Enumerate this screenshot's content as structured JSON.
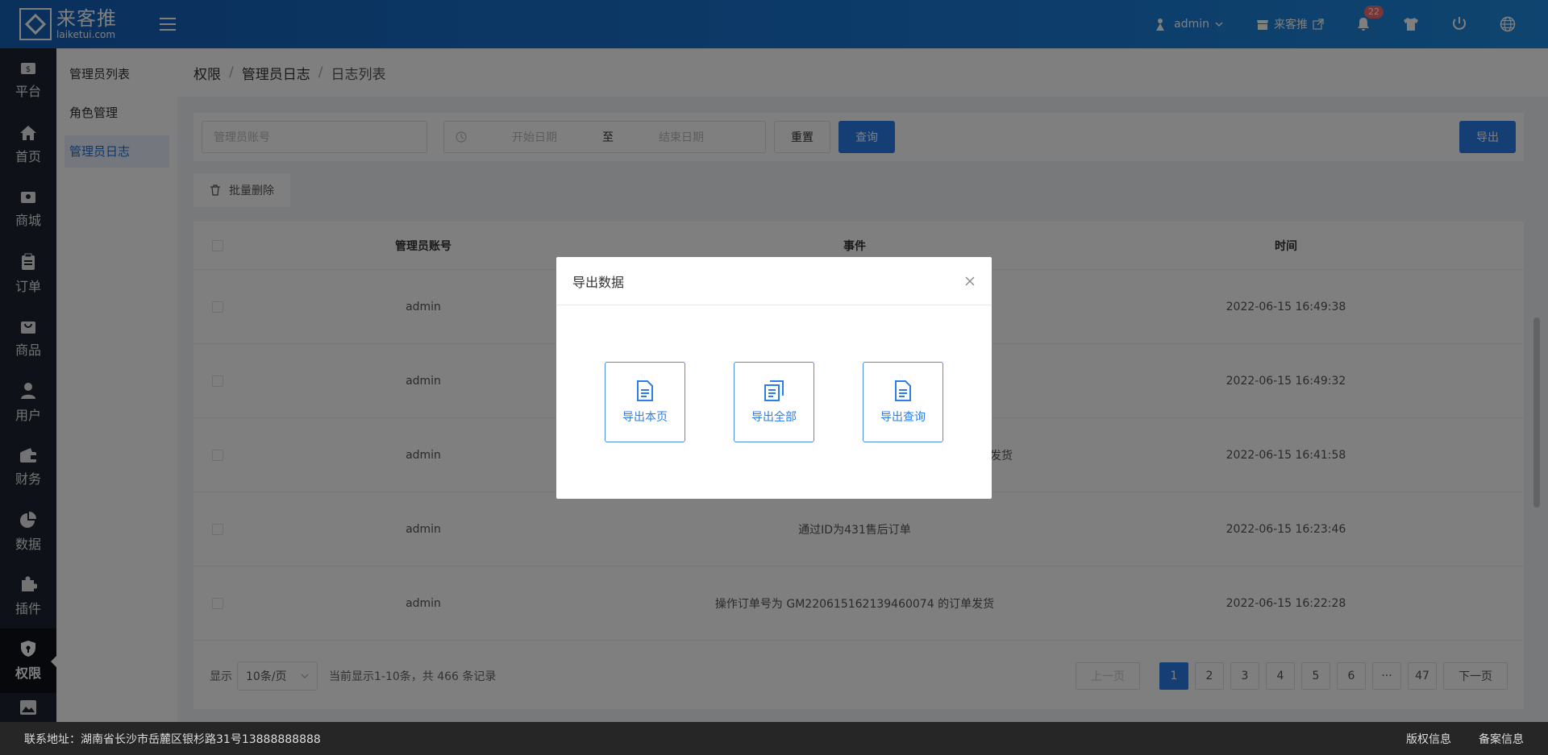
{
  "brand": {
    "cn": "来客推",
    "en": "laiketui.com"
  },
  "header": {
    "user": "admin",
    "store": "来客推",
    "notif_count": "22"
  },
  "sidebar": {
    "items": [
      {
        "label": "平台",
        "icon": "dollar-icon"
      },
      {
        "label": "首页",
        "icon": "home-icon"
      },
      {
        "label": "商城",
        "icon": "mall-icon"
      },
      {
        "label": "订单",
        "icon": "clipboard-icon"
      },
      {
        "label": "商品",
        "icon": "bag-icon"
      },
      {
        "label": "用户",
        "icon": "user-icon"
      },
      {
        "label": "财务",
        "icon": "wallet-icon"
      },
      {
        "label": "数据",
        "icon": "pie-icon"
      },
      {
        "label": "插件",
        "icon": "puzzle-icon"
      },
      {
        "label": "权限",
        "icon": "shield-icon"
      }
    ]
  },
  "subnav": {
    "items": [
      "管理员列表",
      "角色管理",
      "管理员日志"
    ]
  },
  "breadcrumb": {
    "a": "权限",
    "b": "管理员日志",
    "c": "日志列表",
    "sep": "/"
  },
  "filter": {
    "account_placeholder": "管理员账号",
    "start_placeholder": "开始日期",
    "to": "至",
    "end_placeholder": "结束日期",
    "reset": "重置",
    "search": "查询",
    "export": "导出"
  },
  "bulk_delete": "批量删除",
  "table": {
    "headers": {
      "account": "管理员账号",
      "event": "事件",
      "time": "时间"
    },
    "rows": [
      {
        "account": "admin",
        "event": "",
        "time": "2022-06-15 16:49:38"
      },
      {
        "account": "admin",
        "event": "",
        "time": "2022-06-15 16:49:32"
      },
      {
        "account": "admin",
        "event": "发货",
        "time": "2022-06-15 16:41:58"
      },
      {
        "account": "admin",
        "event": "通过ID为431售后订单",
        "time": "2022-06-15 16:23:46"
      },
      {
        "account": "admin",
        "event": "操作订单号为 GM220615162139460074 的订单发货",
        "time": "2022-06-15 16:22:28"
      }
    ]
  },
  "pagination": {
    "show": "显示",
    "per_page": "10条/页",
    "summary": "当前显示1-10条，共 466 条记录",
    "prev": "上一页",
    "pages": [
      "1",
      "2",
      "3",
      "4",
      "5",
      "6",
      "···",
      "47"
    ],
    "next": "下一页"
  },
  "footer": {
    "address": "联系地址：湖南省长沙市岳麓区银杉路31号13888888888",
    "copyright": "版权信息",
    "icp": "备案信息"
  },
  "modal": {
    "title": "导出数据",
    "export_page": "导出本页",
    "export_all": "导出全部",
    "export_query": "导出查询"
  }
}
